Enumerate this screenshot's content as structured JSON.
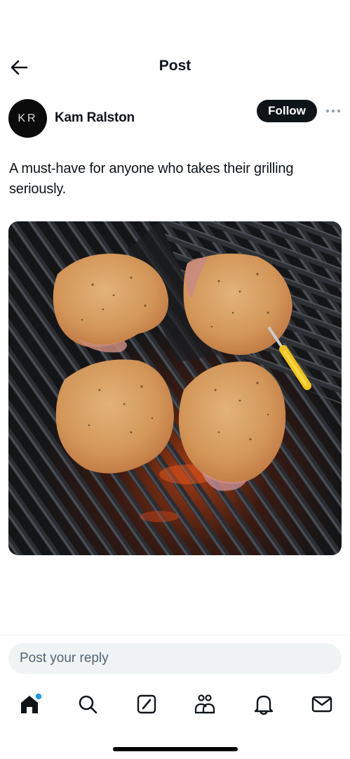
{
  "header": {
    "title": "Post",
    "back_icon": "arrow-left-icon"
  },
  "author": {
    "initials": "KR",
    "name": "Kam Ralston",
    "follow_label": "Follow",
    "more_icon": "more-horizontal-icon"
  },
  "post": {
    "text": "A must-have for anyone who takes their grilling seriously."
  },
  "reply": {
    "placeholder": "Post your reply"
  },
  "nav": {
    "items": [
      {
        "icon": "home-icon",
        "notification_dot": true
      },
      {
        "icon": "search-icon"
      },
      {
        "icon": "compose-icon"
      },
      {
        "icon": "communities-icon"
      },
      {
        "icon": "bell-icon"
      },
      {
        "icon": "mail-icon"
      }
    ]
  },
  "colors": {
    "accent": "#1d9bf0",
    "text": "#0f1419",
    "muted": "#536471",
    "reply_bg": "#eff3f4"
  }
}
